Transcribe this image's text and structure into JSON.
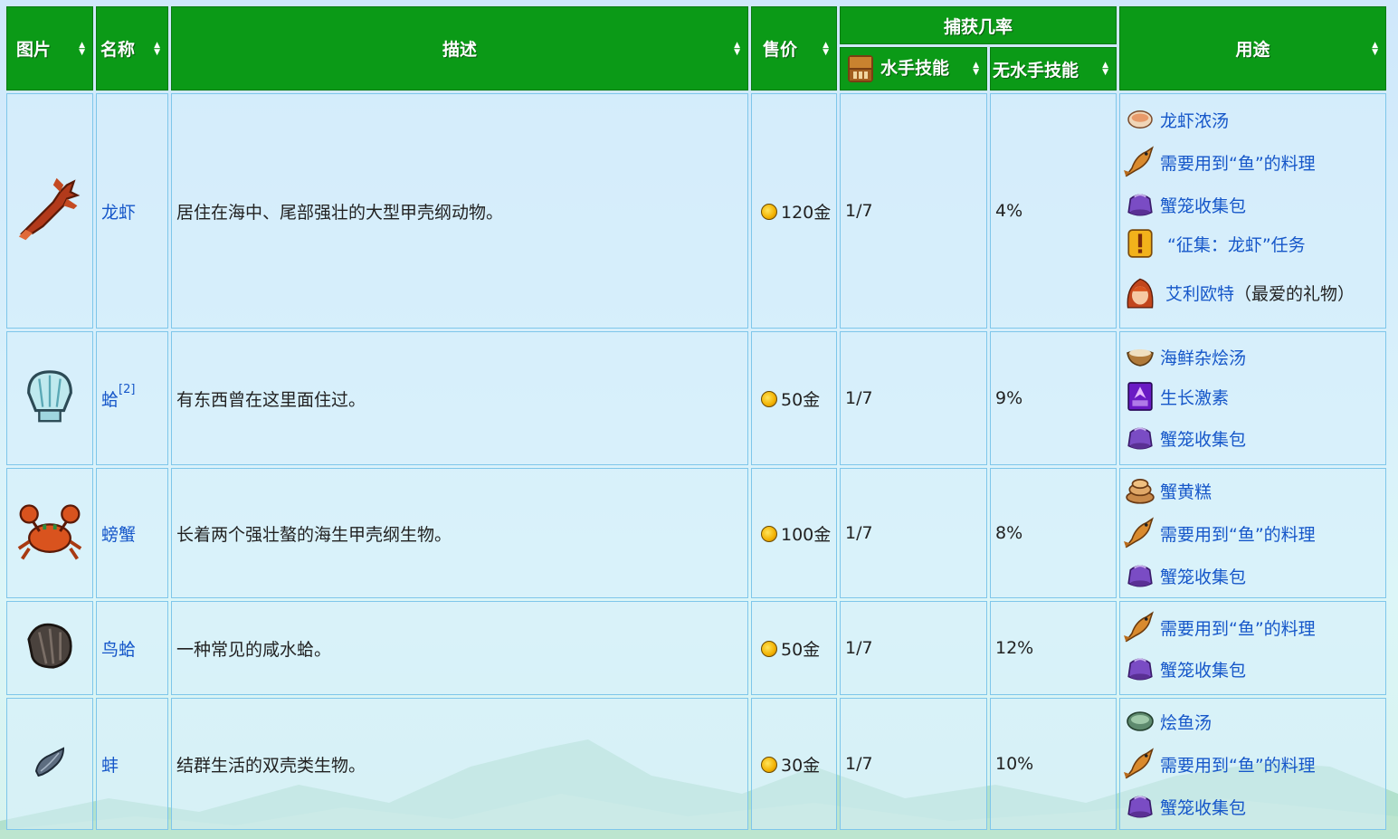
{
  "headers": {
    "image": "图片",
    "name": "名称",
    "description": "描述",
    "price": "售价",
    "catch_rate": "捕获几率",
    "mariner": "水手技能",
    "no_mariner": "无水手技能",
    "uses": "用途"
  },
  "rows": [
    {
      "name": "龙虾",
      "sup": "",
      "description": "居住在海中、尾部强壮的大型甲壳纲动物。",
      "price": "120金",
      "mariner": "1/7",
      "no_mariner": "4%",
      "uses": [
        {
          "icon": "lobster-bisque-icon",
          "text": "龙虾浓汤",
          "extra": ""
        },
        {
          "icon": "fish-icon",
          "text": "需要用到“鱼”的料理",
          "extra": ""
        },
        {
          "icon": "crab-pot-bundle-icon",
          "text": "蟹笼收集包",
          "extra": ""
        },
        {
          "icon": "quest-icon",
          "text": "“征集：龙虾”任务",
          "extra": ""
        },
        {
          "icon": "elliott-portrait-icon",
          "text": "艾利欧特",
          "extra": "（最爱的礼物）"
        }
      ]
    },
    {
      "name": "蛤",
      "sup": "[2]",
      "description": "有东西曾在这里面住过。",
      "price": "50金",
      "mariner": "1/7",
      "no_mariner": "9%",
      "uses": [
        {
          "icon": "chowder-icon",
          "text": "海鲜杂烩汤",
          "extra": ""
        },
        {
          "icon": "deluxe-speed-gro-icon",
          "text": "生长激素",
          "extra": ""
        },
        {
          "icon": "crab-pot-bundle-icon",
          "text": "蟹笼收集包",
          "extra": ""
        }
      ]
    },
    {
      "name": "螃蟹",
      "sup": "",
      "description": "长着两个强壮螯的海生甲壳纲生物。",
      "price": "100金",
      "mariner": "1/7",
      "no_mariner": "8%",
      "uses": [
        {
          "icon": "crab-cakes-icon",
          "text": "蟹黄糕",
          "extra": ""
        },
        {
          "icon": "fish-icon",
          "text": "需要用到“鱼”的料理",
          "extra": ""
        },
        {
          "icon": "crab-pot-bundle-icon",
          "text": "蟹笼收集包",
          "extra": ""
        }
      ]
    },
    {
      "name": "鸟蛤",
      "sup": "",
      "description": "一种常见的咸水蛤。",
      "price": "50金",
      "mariner": "1/7",
      "no_mariner": "12%",
      "uses": [
        {
          "icon": "fish-icon",
          "text": "需要用到“鱼”的料理",
          "extra": ""
        },
        {
          "icon": "crab-pot-bundle-icon",
          "text": "蟹笼收集包",
          "extra": ""
        }
      ]
    },
    {
      "name": "蚌",
      "sup": "",
      "description": "结群生活的双壳类生物。",
      "price": "30金",
      "mariner": "1/7",
      "no_mariner": "10%",
      "uses": [
        {
          "icon": "fish-stew-icon",
          "text": "烩鱼汤",
          "extra": ""
        },
        {
          "icon": "fish-icon",
          "text": "需要用到“鱼”的料理",
          "extra": ""
        },
        {
          "icon": "crab-pot-bundle-icon",
          "text": "蟹笼收集包",
          "extra": ""
        }
      ]
    }
  ],
  "colors": {
    "header_green": "#0b9a17",
    "link_blue": "#1657c9",
    "cell_border": "#7ec6ea"
  }
}
